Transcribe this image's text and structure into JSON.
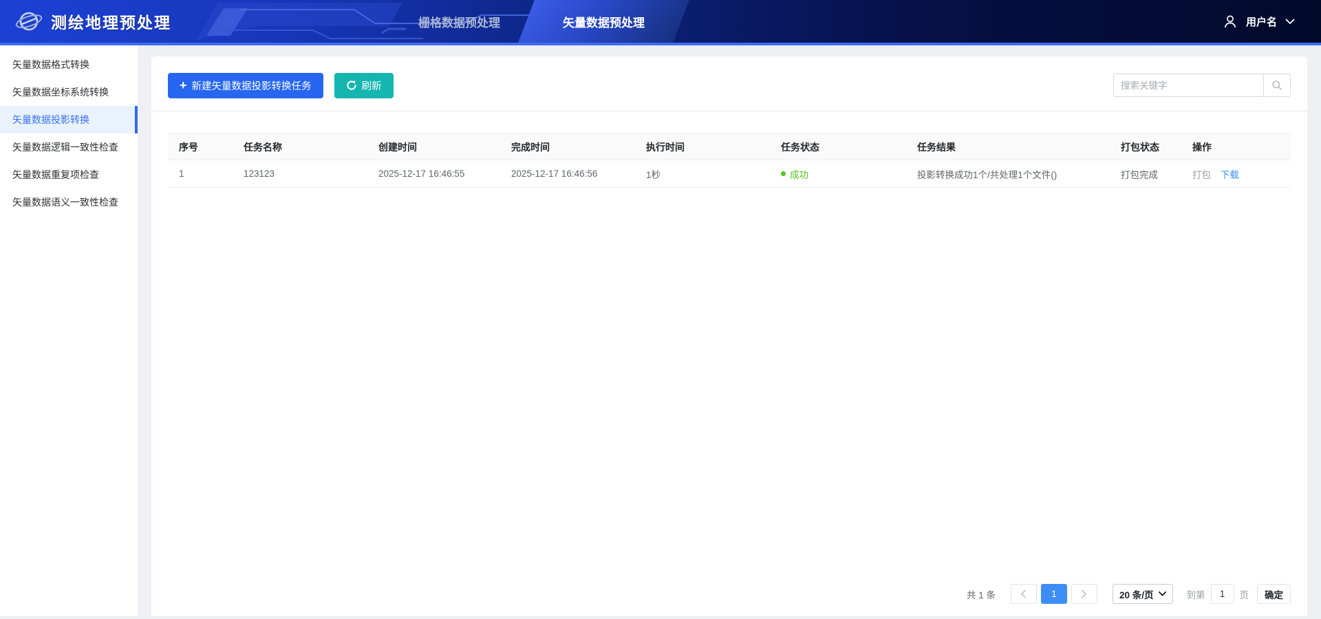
{
  "header": {
    "title": "测绘地理预处理",
    "tabs": [
      {
        "label": "栅格数据预处理",
        "active": false
      },
      {
        "label": "矢量数据预处理",
        "active": true
      }
    ],
    "user": {
      "name": "用户名"
    }
  },
  "sidebar": {
    "items": [
      {
        "label": "矢量数据格式转换",
        "active": false
      },
      {
        "label": "矢量数据坐标系统转换",
        "active": false
      },
      {
        "label": "矢量数据投影转换",
        "active": true
      },
      {
        "label": "矢量数据逻辑一致性检查",
        "active": false
      },
      {
        "label": "矢量数据重复项检查",
        "active": false
      },
      {
        "label": "矢量数据语义一致性检查",
        "active": false
      }
    ]
  },
  "toolbar": {
    "new_task_label": "新建矢量数据投影转换任务",
    "refresh_label": "刷新",
    "search_placeholder": "搜索关键字"
  },
  "table": {
    "headers": [
      "序号",
      "任务名称",
      "创建时间",
      "完成时间",
      "执行时间",
      "任务状态",
      "任务结果",
      "打包状态",
      "操作"
    ],
    "rows": [
      {
        "index": "1",
        "name": "123123",
        "created_at": "2025-12-17 16:46:55",
        "finished_at": "2025-12-17 16:46:56",
        "duration": "1秒",
        "status": "成功",
        "result": "投影转换成功1个/共处理1个文件()",
        "package_status": "打包完成",
        "action_package": "打包",
        "action_download": "下载"
      }
    ]
  },
  "pagination": {
    "total": "共 1 条",
    "current_page": "1",
    "page_size": "20 条/页",
    "goto_prefix": "到第",
    "goto_value": "1",
    "goto_suffix": "页",
    "confirm_label": "确定"
  },
  "colors": {
    "accent_blue": "#2666f0",
    "teal": "#15b5b0",
    "success_green": "#52c41a",
    "link_blue": "#3d8df5",
    "header_border": "#3f6cf4"
  }
}
